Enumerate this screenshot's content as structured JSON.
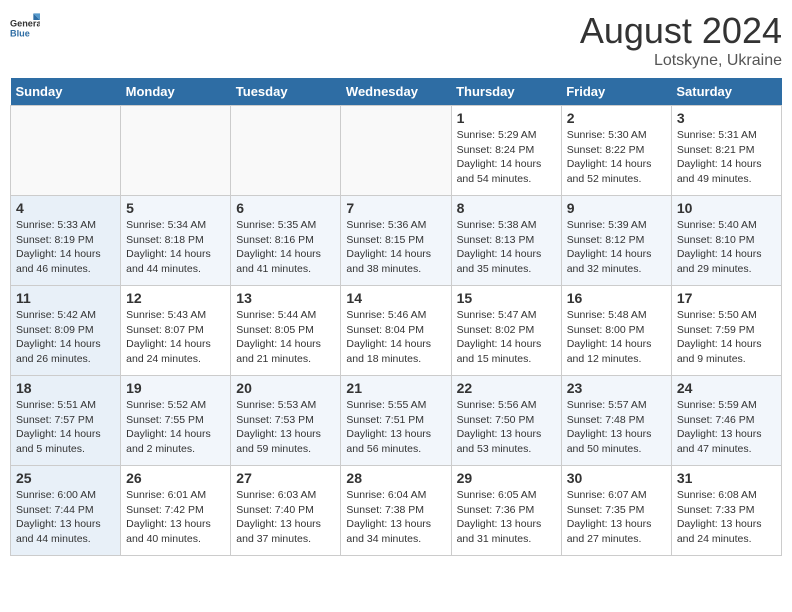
{
  "header": {
    "logo_general": "General",
    "logo_blue": "Blue",
    "main_title": "August 2024",
    "subtitle": "Lotskyne, Ukraine"
  },
  "days_of_week": [
    "Sunday",
    "Monday",
    "Tuesday",
    "Wednesday",
    "Thursday",
    "Friday",
    "Saturday"
  ],
  "weeks": [
    [
      {
        "num": "",
        "info": ""
      },
      {
        "num": "",
        "info": ""
      },
      {
        "num": "",
        "info": ""
      },
      {
        "num": "",
        "info": ""
      },
      {
        "num": "1",
        "info": "Sunrise: 5:29 AM\nSunset: 8:24 PM\nDaylight: 14 hours\nand 54 minutes."
      },
      {
        "num": "2",
        "info": "Sunrise: 5:30 AM\nSunset: 8:22 PM\nDaylight: 14 hours\nand 52 minutes."
      },
      {
        "num": "3",
        "info": "Sunrise: 5:31 AM\nSunset: 8:21 PM\nDaylight: 14 hours\nand 49 minutes."
      }
    ],
    [
      {
        "num": "4",
        "info": "Sunrise: 5:33 AM\nSunset: 8:19 PM\nDaylight: 14 hours\nand 46 minutes."
      },
      {
        "num": "5",
        "info": "Sunrise: 5:34 AM\nSunset: 8:18 PM\nDaylight: 14 hours\nand 44 minutes."
      },
      {
        "num": "6",
        "info": "Sunrise: 5:35 AM\nSunset: 8:16 PM\nDaylight: 14 hours\nand 41 minutes."
      },
      {
        "num": "7",
        "info": "Sunrise: 5:36 AM\nSunset: 8:15 PM\nDaylight: 14 hours\nand 38 minutes."
      },
      {
        "num": "8",
        "info": "Sunrise: 5:38 AM\nSunset: 8:13 PM\nDaylight: 14 hours\nand 35 minutes."
      },
      {
        "num": "9",
        "info": "Sunrise: 5:39 AM\nSunset: 8:12 PM\nDaylight: 14 hours\nand 32 minutes."
      },
      {
        "num": "10",
        "info": "Sunrise: 5:40 AM\nSunset: 8:10 PM\nDaylight: 14 hours\nand 29 minutes."
      }
    ],
    [
      {
        "num": "11",
        "info": "Sunrise: 5:42 AM\nSunset: 8:09 PM\nDaylight: 14 hours\nand 26 minutes."
      },
      {
        "num": "12",
        "info": "Sunrise: 5:43 AM\nSunset: 8:07 PM\nDaylight: 14 hours\nand 24 minutes."
      },
      {
        "num": "13",
        "info": "Sunrise: 5:44 AM\nSunset: 8:05 PM\nDaylight: 14 hours\nand 21 minutes."
      },
      {
        "num": "14",
        "info": "Sunrise: 5:46 AM\nSunset: 8:04 PM\nDaylight: 14 hours\nand 18 minutes."
      },
      {
        "num": "15",
        "info": "Sunrise: 5:47 AM\nSunset: 8:02 PM\nDaylight: 14 hours\nand 15 minutes."
      },
      {
        "num": "16",
        "info": "Sunrise: 5:48 AM\nSunset: 8:00 PM\nDaylight: 14 hours\nand 12 minutes."
      },
      {
        "num": "17",
        "info": "Sunrise: 5:50 AM\nSunset: 7:59 PM\nDaylight: 14 hours\nand 9 minutes."
      }
    ],
    [
      {
        "num": "18",
        "info": "Sunrise: 5:51 AM\nSunset: 7:57 PM\nDaylight: 14 hours\nand 5 minutes."
      },
      {
        "num": "19",
        "info": "Sunrise: 5:52 AM\nSunset: 7:55 PM\nDaylight: 14 hours\nand 2 minutes."
      },
      {
        "num": "20",
        "info": "Sunrise: 5:53 AM\nSunset: 7:53 PM\nDaylight: 13 hours\nand 59 minutes."
      },
      {
        "num": "21",
        "info": "Sunrise: 5:55 AM\nSunset: 7:51 PM\nDaylight: 13 hours\nand 56 minutes."
      },
      {
        "num": "22",
        "info": "Sunrise: 5:56 AM\nSunset: 7:50 PM\nDaylight: 13 hours\nand 53 minutes."
      },
      {
        "num": "23",
        "info": "Sunrise: 5:57 AM\nSunset: 7:48 PM\nDaylight: 13 hours\nand 50 minutes."
      },
      {
        "num": "24",
        "info": "Sunrise: 5:59 AM\nSunset: 7:46 PM\nDaylight: 13 hours\nand 47 minutes."
      }
    ],
    [
      {
        "num": "25",
        "info": "Sunrise: 6:00 AM\nSunset: 7:44 PM\nDaylight: 13 hours\nand 44 minutes."
      },
      {
        "num": "26",
        "info": "Sunrise: 6:01 AM\nSunset: 7:42 PM\nDaylight: 13 hours\nand 40 minutes."
      },
      {
        "num": "27",
        "info": "Sunrise: 6:03 AM\nSunset: 7:40 PM\nDaylight: 13 hours\nand 37 minutes."
      },
      {
        "num": "28",
        "info": "Sunrise: 6:04 AM\nSunset: 7:38 PM\nDaylight: 13 hours\nand 34 minutes."
      },
      {
        "num": "29",
        "info": "Sunrise: 6:05 AM\nSunset: 7:36 PM\nDaylight: 13 hours\nand 31 minutes."
      },
      {
        "num": "30",
        "info": "Sunrise: 6:07 AM\nSunset: 7:35 PM\nDaylight: 13 hours\nand 27 minutes."
      },
      {
        "num": "31",
        "info": "Sunrise: 6:08 AM\nSunset: 7:33 PM\nDaylight: 13 hours\nand 24 minutes."
      }
    ]
  ]
}
